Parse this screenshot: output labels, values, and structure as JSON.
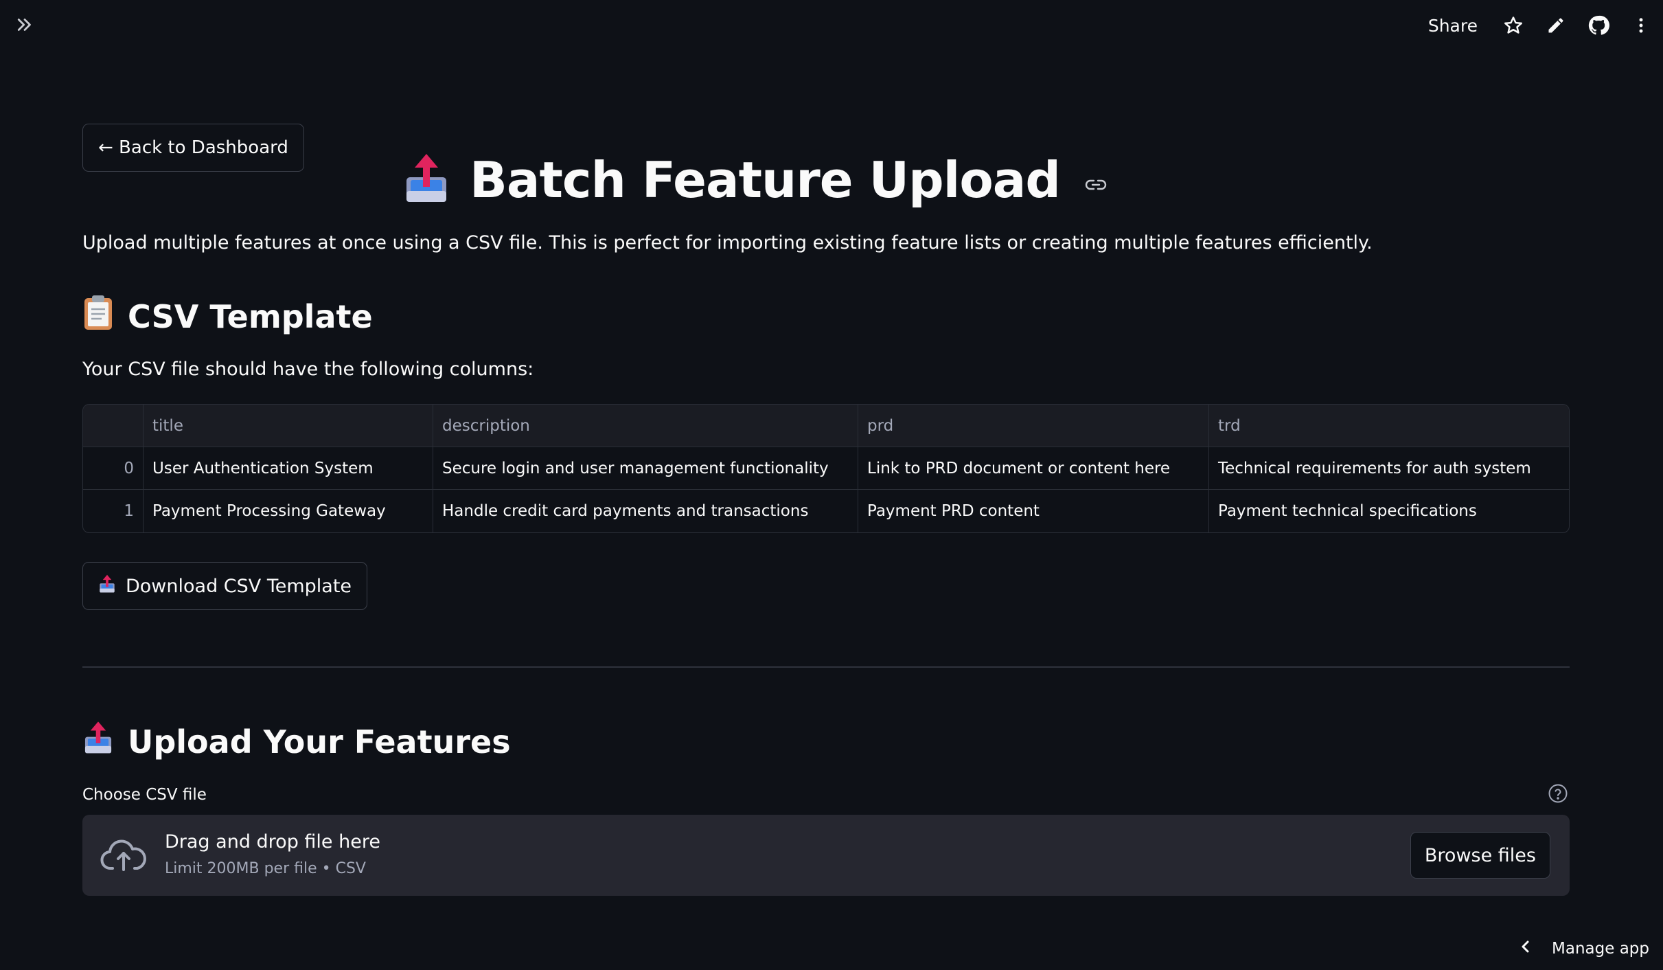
{
  "topbar": {
    "share_label": "Share",
    "icons": [
      "expand-sidebar-icon",
      "star-icon",
      "edit-icon",
      "github-icon",
      "more-vert-icon"
    ]
  },
  "nav": {
    "back_label": "← Back to Dashboard"
  },
  "page": {
    "title": "Batch Feature Upload",
    "title_icon": "outbox-tray-icon",
    "intro": "Upload multiple features at once using a CSV file. This is perfect for importing existing feature lists or creating multiple features efficiently."
  },
  "template_section": {
    "heading": "CSV Template",
    "heading_icon": "clipboard-icon",
    "columns_text": "Your CSV file should have the following columns:",
    "table": {
      "headers": [
        "",
        "title",
        "description",
        "prd",
        "trd"
      ],
      "rows": [
        [
          "0",
          "User Authentication System",
          "Secure login and user management functionality",
          "Link to PRD document or content here",
          "Technical requirements for auth system"
        ],
        [
          "1",
          "Payment Processing Gateway",
          "Handle credit card payments and transactions",
          "Payment PRD content",
          "Payment technical specifications"
        ]
      ]
    },
    "download_label": "Download CSV Template"
  },
  "upload_section": {
    "heading": "Upload Your Features",
    "heading_icon": "outbox-tray-icon",
    "uploader_label": "Choose CSV file",
    "dropzone_title": "Drag and drop file here",
    "dropzone_subtitle": "Limit 200MB per file • CSV",
    "browse_label": "Browse files"
  },
  "footer": {
    "manage_label": "Manage app"
  },
  "colors": {
    "background": "#0e1117",
    "surface": "#262730",
    "border": "#3b3f4a",
    "text": "#fafafa",
    "muted": "#a3a8b8"
  }
}
